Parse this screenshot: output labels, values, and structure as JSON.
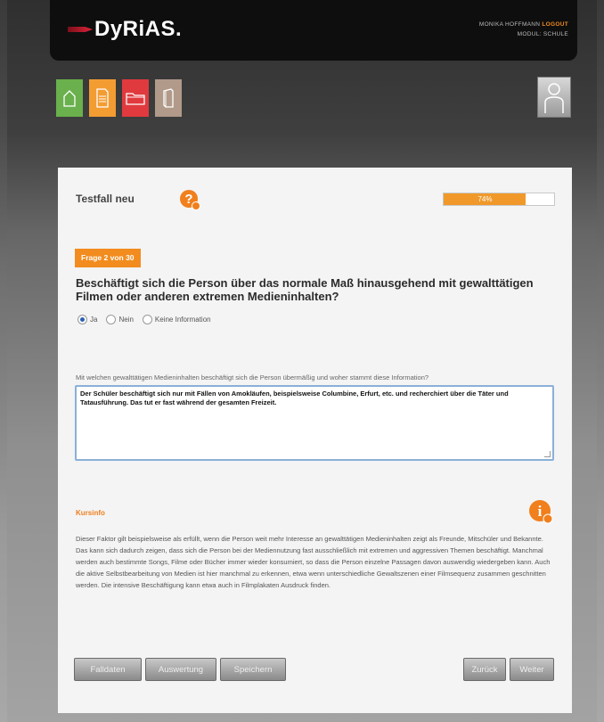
{
  "header": {
    "logo_text": "DyRiAS.",
    "user_name": "MONIKA HOFFMANN",
    "logout_label": "LOGOUT",
    "modul": "MODUL: SCHULE"
  },
  "nav": {
    "icons": [
      "home-icon",
      "document-icon",
      "folder-icon",
      "book-icon"
    ],
    "colors": {
      "home": "#6ab04c",
      "document": "#f39c32",
      "folder": "#e03a3e",
      "book": "#b19a8a"
    },
    "profile_icon": "user-icon"
  },
  "case": {
    "title": "Testfall neu",
    "progress_label": "74%",
    "progress_value": 0.74
  },
  "question": {
    "badge": "Frage 2 von 30",
    "text": "Beschäftigt sich die Person über das normale Maß hinausgehend mit gewalttätigen Filmen oder anderen extremen Medieninhalten?",
    "options": [
      "Ja",
      "Nein",
      "Keine Information"
    ],
    "selected": "Ja"
  },
  "followup": {
    "label": "Mit welchen gewalttätigen Medieninhalten beschäftigt sich die Person übermäßig und woher stammt diese Information?",
    "value": "Der Schüler beschäftigt sich nur mit Fällen von Amokläufen, beispielsweise Columbine, Erfurt, etc. und recherchiert über die Täter und Tatausführung. Das tut er fast während der gesamten Freizeit."
  },
  "kursinfo": {
    "title": "Kursinfo",
    "text": "Dieser Faktor gilt beispielsweise als erfüllt, wenn die Person weit mehr Interesse an gewalttätigen Medieninhalten zeigt als Freunde, Mitschüler und Bekannte. Das kann sich dadurch zeigen, dass sich die Person bei der Mediennutzung fast ausschließlich mit extremen und aggressiven Themen beschäftigt. Manchmal werden auch bestimmte Songs, Filme oder Bücher immer wieder konsumiert, so dass die Person einzelne Passagen davon auswendig wiedergeben kann. Auch die aktive Selbstbearbeitung von Medien ist hier manchmal zu erkennen, etwa wenn unterschiedliche Gewaltszenen einer Filmsequenz zusammen geschnitten werden. Die intensive Beschäftigung kann etwa auch in Filmplakaten Ausdruck finden."
  },
  "buttons": {
    "falldaten": "Falldaten",
    "auswertung": "Auswertung",
    "speichern": "Speichern",
    "zurueck": "Zurück",
    "weiter": "Weiter"
  },
  "accent_color": "#f28c1e"
}
